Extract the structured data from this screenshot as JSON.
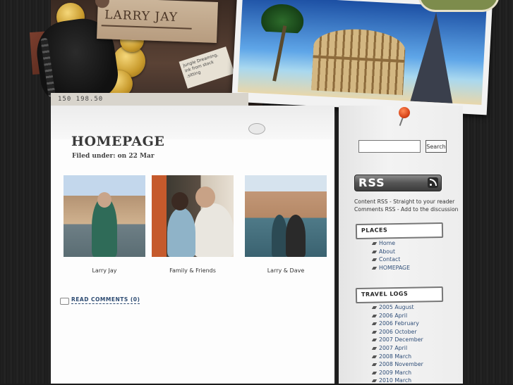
{
  "header": {
    "site_title": "LARRY JAY",
    "note_text": "Jungle Dreaming, ink from stock .sitting",
    "ticket_code": "150 198.50"
  },
  "main": {
    "page_title": "HOMEPAGE",
    "filed_under": "Filed under: on 22 Mar",
    "photos": [
      {
        "caption": "Larry Jay"
      },
      {
        "caption": "Family & Friends"
      },
      {
        "caption": "Larry & Dave"
      }
    ],
    "read_comments": "READ COMMENTS (0)"
  },
  "sidebar": {
    "search": {
      "placeholder": "",
      "button_label": "Search"
    },
    "rss": {
      "badge_label": "RSS",
      "content_rss": "Content RSS - Straight to your reader",
      "comments_rss": "Comments RSS - Add to the discussion"
    },
    "places": {
      "heading": "PLACES",
      "items": [
        "Home",
        "About",
        "Contact",
        "HOMEPAGE"
      ]
    },
    "travel_logs": {
      "heading": "TRAVEL LOGS",
      "items": [
        "2005 August",
        "2006 April",
        "2006 February",
        "2006 October",
        "2007 December",
        "2007 April",
        "2008 March",
        "2008 November",
        "2009 March",
        "2010 March"
      ]
    }
  },
  "colors": {
    "background": "#1b1b1b",
    "link": "#2f4e78",
    "accent_pin": "#d9461a"
  }
}
